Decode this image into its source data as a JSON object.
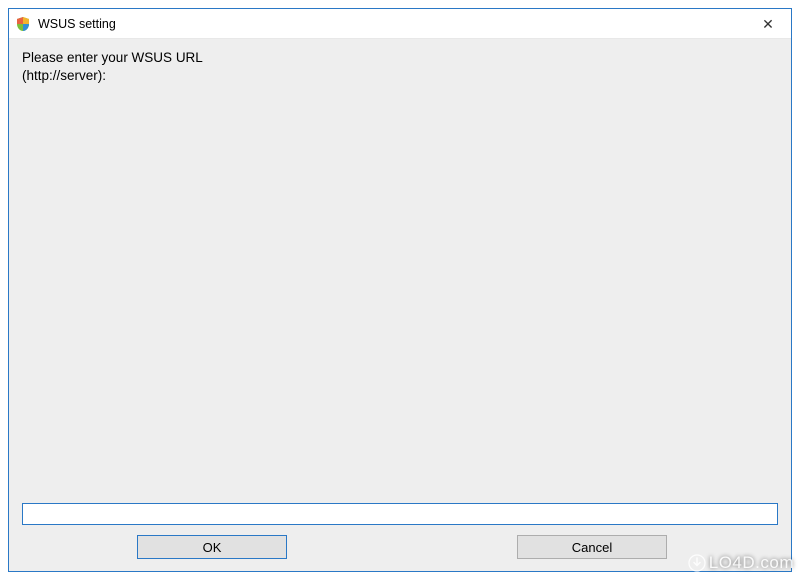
{
  "window": {
    "title": "WSUS setting",
    "close_label": "✕"
  },
  "dialog": {
    "prompt": "Please enter your WSUS URL\n(http://server):",
    "input_value": "",
    "ok_label": "OK",
    "cancel_label": "Cancel"
  },
  "watermark": {
    "text": "LO4D.com"
  }
}
